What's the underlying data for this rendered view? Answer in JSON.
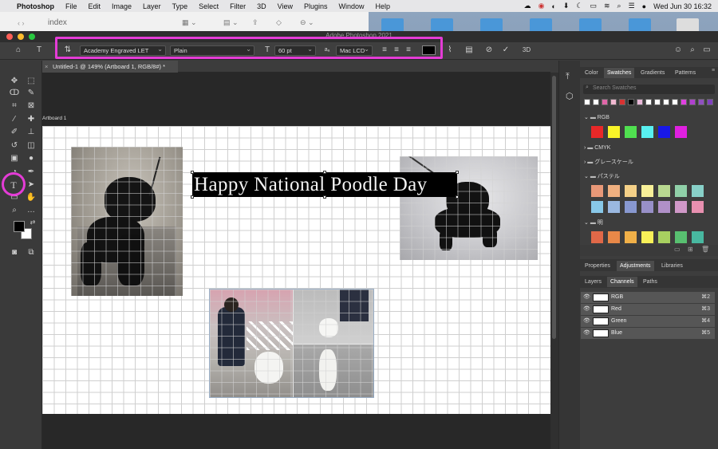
{
  "menubar": {
    "apple": "",
    "app": "Photoshop",
    "items": [
      "File",
      "Edit",
      "Image",
      "Layer",
      "Type",
      "Select",
      "Filter",
      "3D",
      "View",
      "Plugins",
      "Window",
      "Help"
    ],
    "clock": "Wed Jun 30  16:32"
  },
  "finder": {
    "title": "index"
  },
  "window": {
    "title": "Adobe Photoshop 2021"
  },
  "options": {
    "font_family": "Academy Engraved LET",
    "font_style": "Plain",
    "font_size": "60 pt",
    "aa_label": "aₐ",
    "antialias": "Mac LCD",
    "mode_3d": "3D",
    "color": "#000000"
  },
  "document": {
    "tab_title": "Untitled-1 @ 149% (Artboard 1, RGB/8#) *",
    "artboard_label": "Artboard 1",
    "text_layer": "Happy National Poodle Day"
  },
  "panels": {
    "top_tabs": [
      "Color",
      "Swatches",
      "Gradients",
      "Patterns"
    ],
    "search_placeholder": "Search Swatches",
    "top_swatches": [
      "#ffffff",
      "#ffffff",
      "#e066a8",
      "#f0b8d0",
      "#d93232",
      "#000000",
      "#e8b8d8",
      "#ffffff",
      "#ffffff",
      "#ffffff",
      "#ffffff",
      "#e040e0",
      "#b040d0",
      "#9050c0",
      "#8040c0"
    ],
    "groups": [
      {
        "name": "RGB",
        "open": true,
        "colors": [
          "#e82828",
          "#f8f428",
          "#50e050",
          "#58f0f0",
          "#1818e8",
          "#e020e0"
        ]
      },
      {
        "name": "CMYK",
        "open": false,
        "colors": []
      },
      {
        "name": "グレースケール",
        "open": false,
        "colors": []
      },
      {
        "name": "パステル",
        "open": true,
        "colors": [
          "#e89878",
          "#f0b080",
          "#f4d088",
          "#f8f098",
          "#b8d890",
          "#90d0a8",
          "#88d0c8",
          "#88c8e8",
          "#9ab8e0",
          "#8898d0",
          "#9890c8",
          "#b090c8",
          "#d098c8",
          "#e890b0"
        ]
      },
      {
        "name": "明",
        "open": true,
        "colors": [
          "#e06848",
          "#e88848",
          "#f0b048",
          "#f8f058",
          "#a8d060",
          "#58c070",
          "#48b8a0"
        ]
      }
    ],
    "bottom_tabs": [
      "Properties",
      "Adjustments",
      "Libraries"
    ],
    "sub_tabs": [
      "Layers",
      "Channels",
      "Paths"
    ],
    "channels": [
      {
        "name": "RGB",
        "shortcut": "⌘2"
      },
      {
        "name": "Red",
        "shortcut": "⌘3"
      },
      {
        "name": "Green",
        "shortcut": "⌘4"
      },
      {
        "name": "Blue",
        "shortcut": "⌘5"
      }
    ]
  },
  "colors": {
    "highlight": "#e43cd6",
    "foreground": "#000000",
    "background": "#ffffff"
  }
}
